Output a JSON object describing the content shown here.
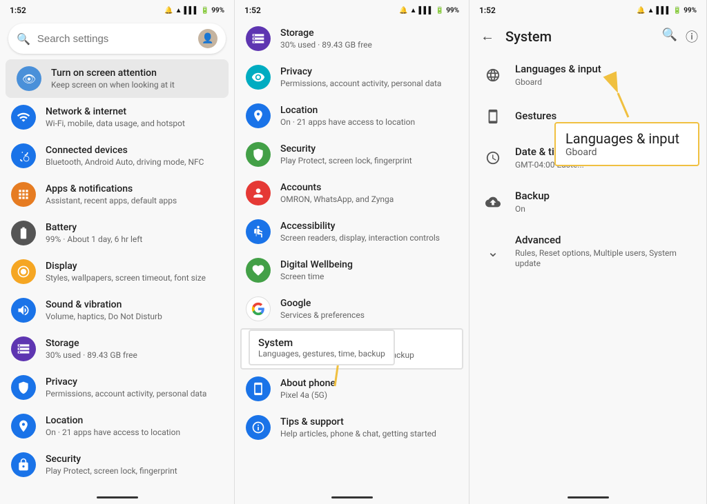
{
  "panel1": {
    "status": {
      "time": "1:52",
      "battery": "99%"
    },
    "search": {
      "placeholder": "Search settings"
    },
    "items": [
      {
        "id": "screen-attention",
        "title": "Turn on screen attention",
        "subtitle": "Keep screen on when looking at it",
        "icon_color": "#4a90d9",
        "icon": "👁",
        "highlighted": true
      },
      {
        "id": "network",
        "title": "Network & internet",
        "subtitle": "Wi-Fi, mobile, data usage, and hotspot",
        "icon_color": "#1a73e8",
        "icon": "wifi"
      },
      {
        "id": "connected",
        "title": "Connected devices",
        "subtitle": "Bluetooth, Android Auto, driving mode, NFC",
        "icon_color": "#1a73e8",
        "icon": "bt"
      },
      {
        "id": "apps",
        "title": "Apps & notifications",
        "subtitle": "Assistant, recent apps, default apps",
        "icon_color": "#e67c22",
        "icon": "apps"
      },
      {
        "id": "battery",
        "title": "Battery",
        "subtitle": "99% · About 1 day, 6 hr left",
        "icon_color": "#444",
        "icon": "battery"
      },
      {
        "id": "display",
        "title": "Display",
        "subtitle": "Styles, wallpapers, screen timeout, font size",
        "icon_color": "#f5a623",
        "icon": "display"
      },
      {
        "id": "sound",
        "title": "Sound & vibration",
        "subtitle": "Volume, haptics, Do Not Disturb",
        "icon_color": "#1a73e8",
        "icon": "sound"
      },
      {
        "id": "storage",
        "title": "Storage",
        "subtitle": "30% used · 89.43 GB free",
        "icon_color": "#5e35b1",
        "icon": "storage"
      },
      {
        "id": "privacy",
        "title": "Privacy",
        "subtitle": "Permissions, account activity, personal data",
        "icon_color": "#1a73e8",
        "icon": "privacy"
      },
      {
        "id": "location",
        "title": "Location",
        "subtitle": "On · 21 apps have access to location",
        "icon_color": "#1a73e8",
        "icon": "location"
      },
      {
        "id": "security",
        "title": "Security",
        "subtitle": "Play Protect, screen lock, fingerprint",
        "icon_color": "#1a73e8",
        "icon": "security"
      }
    ]
  },
  "panel2": {
    "status": {
      "time": "1:52",
      "battery": "99%"
    },
    "items": [
      {
        "id": "storage",
        "title": "Storage",
        "subtitle": "30% used · 89.43 GB free",
        "icon_color": "#5e35b1",
        "icon": "storage"
      },
      {
        "id": "privacy",
        "title": "Privacy",
        "subtitle": "Permissions, account activity, personal data",
        "icon_color": "#00acc1",
        "icon": "privacy2"
      },
      {
        "id": "location",
        "title": "Location",
        "subtitle": "On · 21 apps have access to location",
        "icon_color": "#1a73e8",
        "icon": "location"
      },
      {
        "id": "security",
        "title": "Security",
        "subtitle": "Play Protect, screen lock, fingerprint",
        "icon_color": "#43a047",
        "icon": "security"
      },
      {
        "id": "accounts",
        "title": "Accounts",
        "subtitle": "OMRON, WhatsApp, and Zynga",
        "icon_color": "#e53935",
        "icon": "accounts"
      },
      {
        "id": "accessibility",
        "title": "Accessibility",
        "subtitle": "Screen readers, display, interaction controls",
        "icon_color": "#1a73e8",
        "icon": "accessibility"
      },
      {
        "id": "digital-wellbeing",
        "title": "Digital Wellbeing",
        "subtitle": "Screen time",
        "icon_color": "#43a047",
        "icon": "wellbeing"
      },
      {
        "id": "google",
        "title": "Google",
        "subtitle": "Services & preferences",
        "icon_color": "#fff",
        "icon": "google",
        "border": true
      },
      {
        "id": "system",
        "title": "System",
        "subtitle": "Languages, gestures, time, backup",
        "icon_color": "#757575",
        "icon": "system",
        "highlighted": true
      },
      {
        "id": "about-phone",
        "title": "About phone",
        "subtitle": "Pixel 4a (5G)",
        "icon_color": "#1a73e8",
        "icon": "about"
      },
      {
        "id": "tips",
        "title": "Tips & support",
        "subtitle": "Help articles, phone & chat, getting started",
        "icon_color": "#1a73e8",
        "icon": "tips"
      }
    ],
    "system_callout": {
      "title": "System",
      "subtitle": "Languages, gestures, time, backup"
    }
  },
  "panel3": {
    "status": {
      "time": "1:52",
      "battery": "99%"
    },
    "title": "System",
    "items": [
      {
        "id": "languages",
        "title": "Languages & input",
        "subtitle": "Gboard",
        "icon": "globe"
      },
      {
        "id": "gestures",
        "title": "Gestures",
        "subtitle": "",
        "icon": "phone-gesture"
      },
      {
        "id": "datetime",
        "title": "Date & time",
        "subtitle": "GMT-04:00 Easte...",
        "icon": "clock"
      },
      {
        "id": "backup",
        "title": "Backup",
        "subtitle": "On",
        "icon": "cloud-upload"
      },
      {
        "id": "advanced",
        "title": "Advanced",
        "subtitle": "Rules, Reset options, Multiple users, System update",
        "icon": "chevron-down",
        "is_expand": true
      }
    ],
    "lang_callout": {
      "title": "Languages & input",
      "subtitle": "Gboard"
    }
  }
}
